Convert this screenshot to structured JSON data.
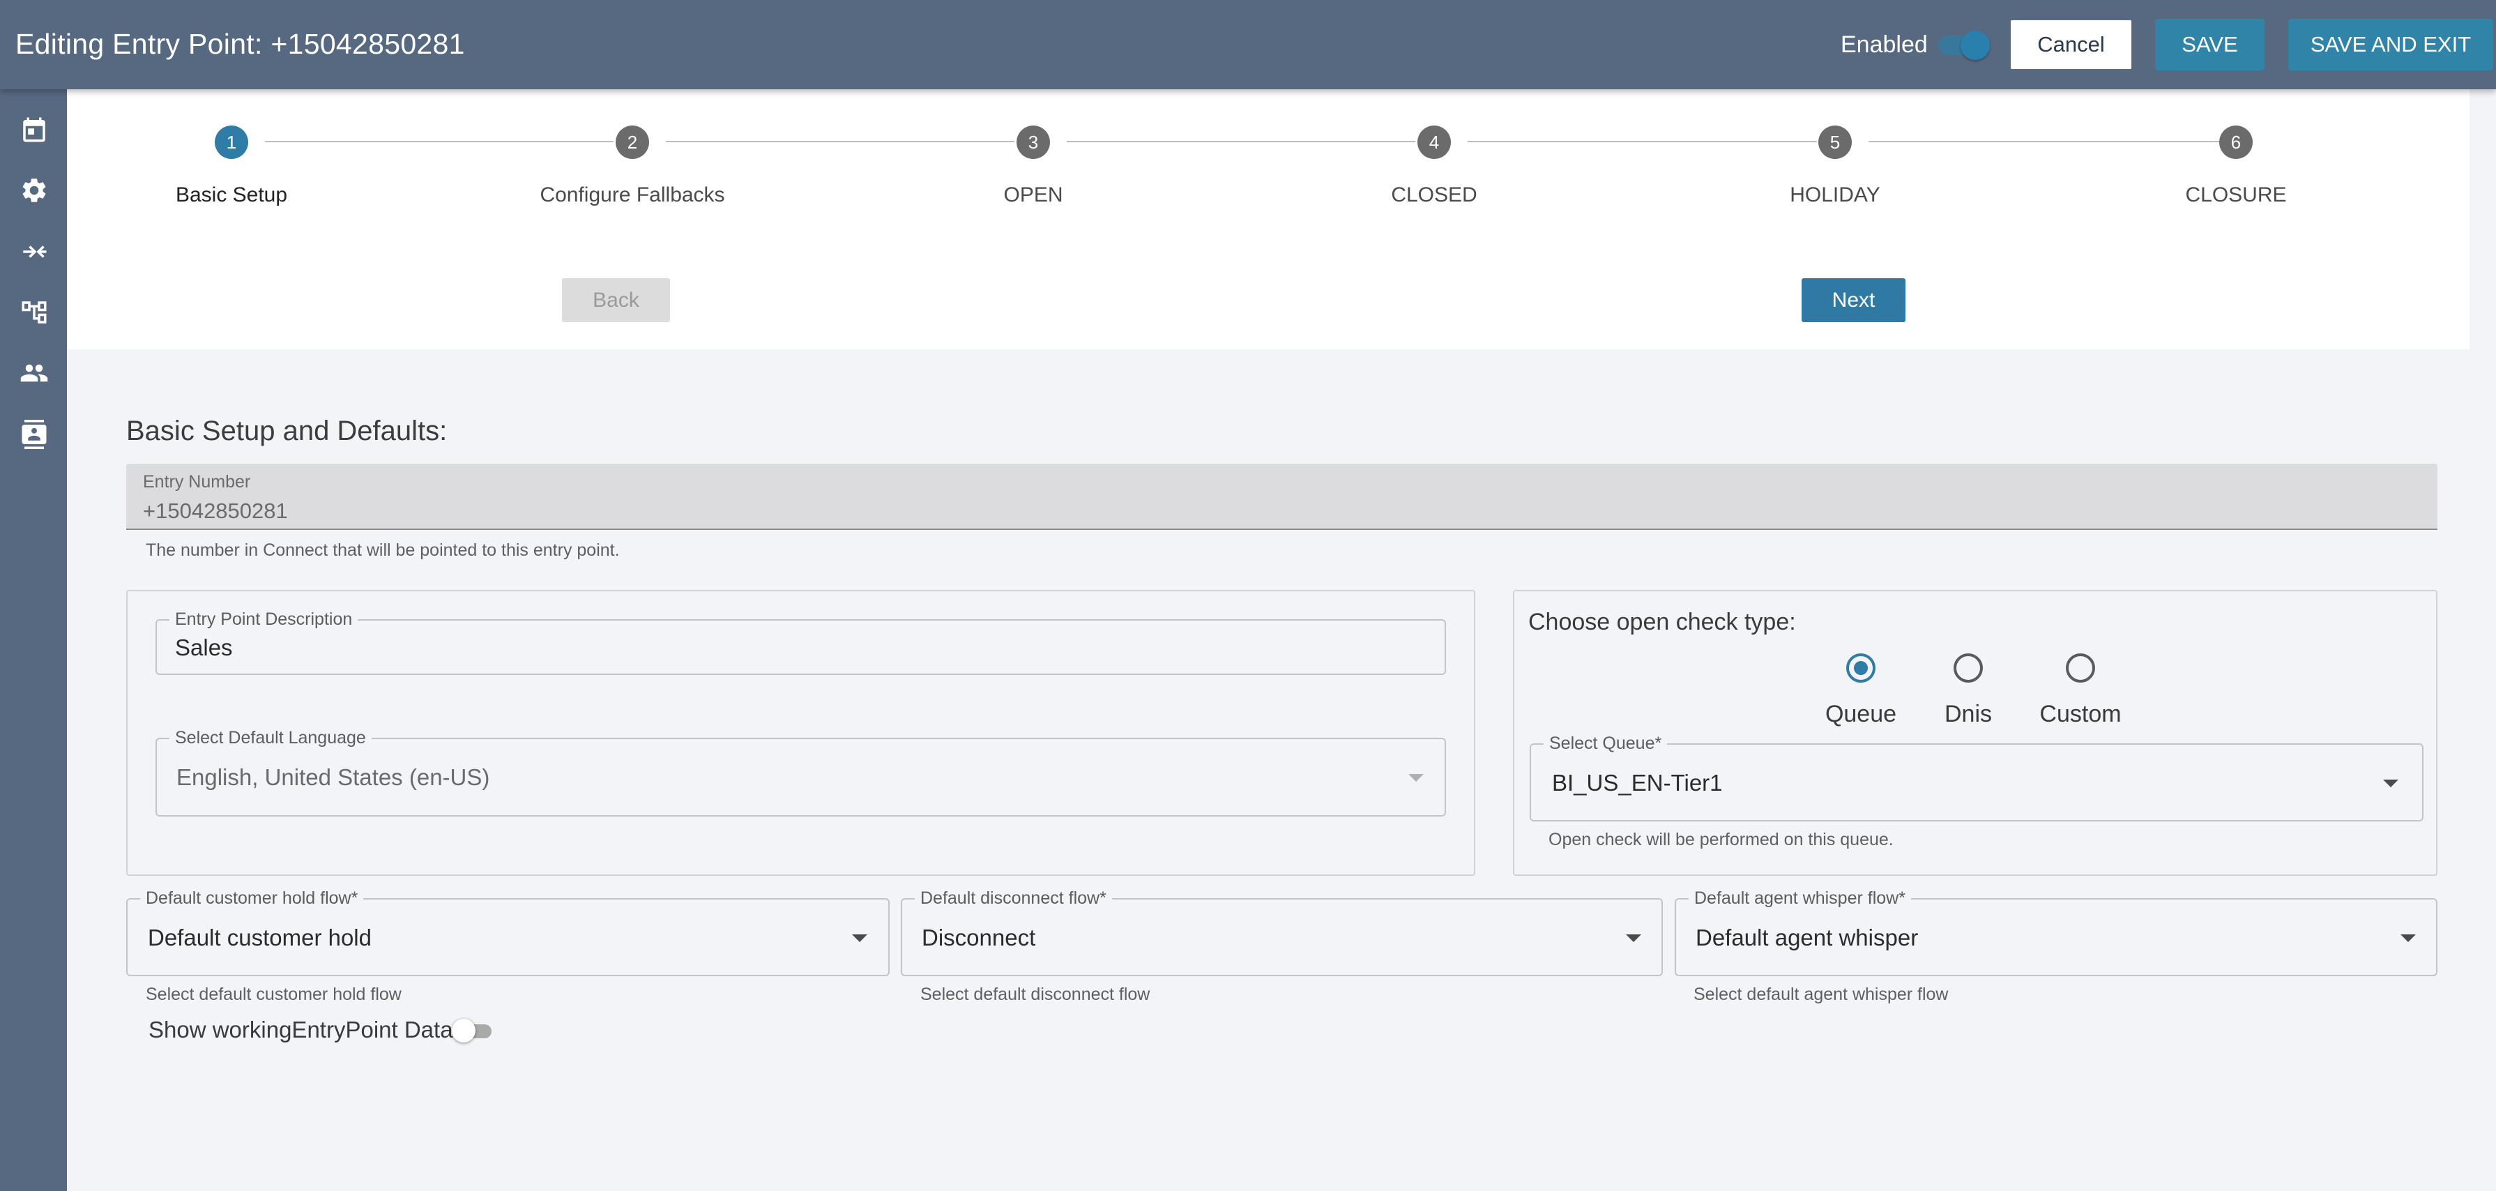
{
  "header": {
    "title": "Editing Entry Point: +15042850281",
    "enabled_label": "Enabled",
    "enabled": true,
    "cancel_label": "Cancel",
    "save_label": "SAVE",
    "save_exit_label": "SAVE AND EXIT"
  },
  "sidebar": {
    "items": [
      {
        "icon": "calendar-icon"
      },
      {
        "icon": "gear-icon"
      },
      {
        "icon": "merge-arrows-icon"
      },
      {
        "icon": "tree-structure-icon"
      },
      {
        "icon": "people-icon"
      },
      {
        "icon": "contact-card-icon"
      }
    ]
  },
  "stepper": {
    "steps": [
      {
        "number": "1",
        "label": "Basic Setup",
        "active": true
      },
      {
        "number": "2",
        "label": "Configure Fallbacks"
      },
      {
        "number": "3",
        "label": "OPEN"
      },
      {
        "number": "4",
        "label": "CLOSED"
      },
      {
        "number": "5",
        "label": "HOLIDAY"
      },
      {
        "number": "6",
        "label": "CLOSURE"
      }
    ],
    "back_label": "Back",
    "next_label": "Next"
  },
  "section": {
    "title": "Basic Setup and Defaults:",
    "entry_number": {
      "label": "Entry Number",
      "value": "+15042850281",
      "helper": "The number in Connect that will be pointed to this entry point."
    },
    "description": {
      "label": "Entry Point Description",
      "value": "Sales"
    },
    "language": {
      "label": "Select Default Language",
      "value": "English, United States (en-US)"
    },
    "open_check": {
      "title": "Choose open check type:",
      "options": [
        "Queue",
        "Dnis",
        "Custom"
      ],
      "selected": "Queue",
      "queue_label": "Select Queue*",
      "queue_value": "BI_US_EN-Tier1",
      "queue_helper": "Open check will be performed on this queue."
    },
    "hold_flow": {
      "label": "Default customer hold flow*",
      "value": "Default customer hold",
      "helper": "Select default customer hold flow"
    },
    "disconnect_flow": {
      "label": "Default disconnect flow*",
      "value": "Disconnect",
      "helper": "Select default disconnect flow"
    },
    "whisper_flow": {
      "label": "Default agent whisper flow*",
      "value": "Default agent whisper",
      "helper": "Select default agent whisper flow"
    },
    "show_data_label": "Show workingEntryPoint Data",
    "show_data_enabled": false
  },
  "colors": {
    "header_bg": "#566981",
    "accent": "#2f84a8",
    "page_bg": "#f3f4f8"
  }
}
